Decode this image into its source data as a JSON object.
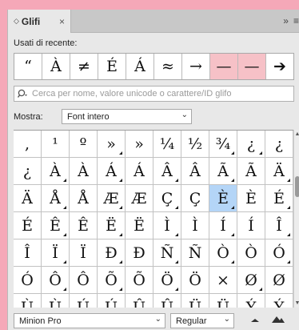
{
  "panel": {
    "tab_title": "Glifi",
    "overflow_glyph": "»",
    "menu_glyph": "≡"
  },
  "recent": {
    "label": "Usati di recente:",
    "glyphs": [
      "“",
      "À",
      "≠",
      "É",
      "Á",
      "≈",
      "→",
      "—",
      "—",
      "➔"
    ],
    "highlighted_indices": [
      7,
      8
    ]
  },
  "search": {
    "placeholder": "Cerca per nome, valore unicode o carattere/ID glifo"
  },
  "show": {
    "label": "Mostra:",
    "value": "Font intero"
  },
  "grid": {
    "rows": [
      [
        ",",
        "¹",
        "º",
        "»",
        "»",
        "¼",
        "½",
        "¾",
        "¿",
        "¿"
      ],
      [
        "¿",
        "À",
        "À",
        "Á",
        "Á",
        "Â",
        "Â",
        "Ã",
        "Ã",
        "Ä"
      ],
      [
        "Ä",
        "Å",
        "Å",
        "Æ",
        "Æ",
        "Ç",
        "Ç",
        "È",
        "È",
        "É"
      ],
      [
        "É",
        "Ê",
        "Ê",
        "Ë",
        "Ë",
        "Ì",
        "Ì",
        "Í",
        "Í",
        "Î"
      ],
      [
        "Î",
        "Ï",
        "Ï",
        "Ð",
        "Ð",
        "Ñ",
        "Ñ",
        "Ò",
        "Ò",
        "Ó"
      ],
      [
        "Ó",
        "Ô",
        "Ô",
        "Õ",
        "Õ",
        "Ö",
        "Ö",
        "×",
        "Ø",
        "Ø"
      ],
      [
        "Ù",
        "Ù",
        "Ú",
        "Ú",
        "Û",
        "Û",
        "Ü",
        "Ü",
        "Ý",
        "Ý"
      ]
    ],
    "alternates": [
      [
        false,
        false,
        false,
        true,
        false,
        false,
        false,
        true,
        true,
        false
      ],
      [
        false,
        true,
        false,
        true,
        false,
        true,
        false,
        true,
        false,
        true
      ],
      [
        false,
        true,
        false,
        true,
        false,
        true,
        false,
        true,
        false,
        true
      ],
      [
        false,
        true,
        false,
        true,
        false,
        true,
        false,
        true,
        false,
        true
      ],
      [
        false,
        true,
        false,
        true,
        false,
        true,
        false,
        true,
        false,
        true
      ],
      [
        false,
        true,
        false,
        true,
        false,
        true,
        false,
        false,
        true,
        false
      ],
      [
        false,
        false,
        false,
        false,
        false,
        false,
        false,
        false,
        false,
        false
      ]
    ],
    "selected": {
      "row": 2,
      "col": 7
    }
  },
  "footer": {
    "font_family": "Minion Pro",
    "font_style": "Regular"
  },
  "colors": {
    "selection": "#b4d5f7",
    "recent_highlight": "#f6c1c7",
    "background_pink": "#f5a8b8"
  }
}
